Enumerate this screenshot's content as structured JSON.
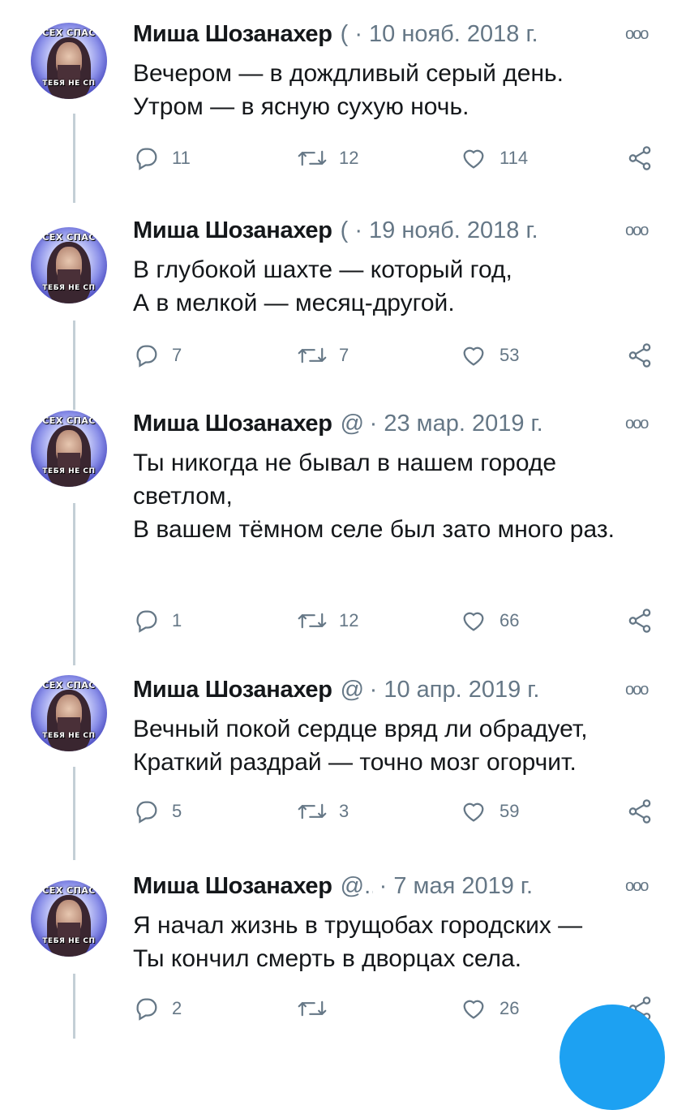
{
  "tweets": [
    {
      "author": "Миша Шозанахер",
      "handle": "(",
      "date": "10 нояб. 2018 г.",
      "text": "Вечером — в дождливый серый день.\nУтром — в ясную сухую ночь.",
      "replies": "11",
      "retweets": "12",
      "likes": "114"
    },
    {
      "author": "Миша Шозанахер",
      "handle": "(",
      "date": "19 нояб. 2018 г.",
      "text": "В глубокой шахте — который год,\nА в мелкой — месяц-другой.",
      "replies": "7",
      "retweets": "7",
      "likes": "53"
    },
    {
      "author": "Миша Шозанахер",
      "handle": "@",
      "date": "23 мар. 2019 г.",
      "text": "Ты никогда не бывал в нашем городе светлом,\nВ вашем тёмном селе был зато много раз.",
      "replies": "1",
      "retweets": "12",
      "likes": "66"
    },
    {
      "author": "Миша Шозанахер",
      "handle": "@",
      "date": "10 апр. 2019 г.",
      "text": "Вечный покой сердце вряд ли обрадует,\nКраткий раздрай — точно мозг огорчит.",
      "replies": "5",
      "retweets": "3",
      "likes": "59"
    },
    {
      "author": "Миша Шозанахер",
      "handle": "@..",
      "date": "7 мая 2019 г.",
      "text": "Я начал жизнь в трущобах городских —\nТы кончил смерть в дворцах села.",
      "replies": "2",
      "retweets": "",
      "likes": "26"
    }
  ],
  "avatar_caption_top": "СЕХ СПАС",
  "avatar_caption_bottom": "ТЕБЯ НЕ СП",
  "icons": {
    "reply": "reply-icon",
    "retweet": "retweet-icon",
    "like": "heart-icon",
    "share": "share-icon",
    "more": "more-icon"
  },
  "colors": {
    "text": "#14171a",
    "secondary": "#657786",
    "thread_line": "#c4cfd6",
    "accent": "#1da1f2"
  }
}
